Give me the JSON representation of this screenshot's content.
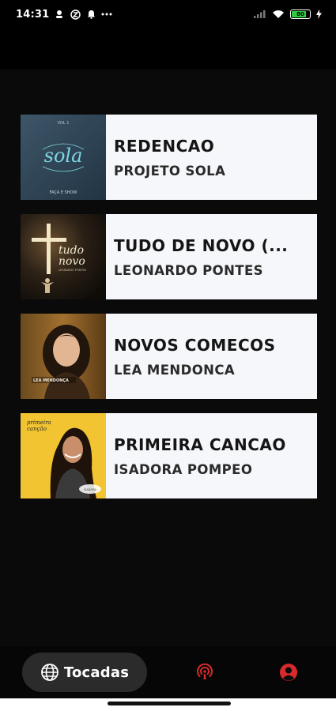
{
  "status_bar": {
    "time": "14:31",
    "icons_left": [
      "person-notification-icon",
      "app-notification-icon",
      "bell-icon",
      "more-dots-icon"
    ],
    "icons_right": [
      "signal-off-icon",
      "wifi-icon",
      "battery-icon",
      "charging-icon"
    ],
    "battery_level": "80",
    "battery_color": "#2ecc40"
  },
  "songs": [
    {
      "title": "REDENCAO",
      "artist": "PROJETO SOLA",
      "cover": "sola-cover"
    },
    {
      "title": "TUDO DE NOVO (...",
      "artist": "LEONARDO PONTES",
      "cover": "tudo-de-novo-cover"
    },
    {
      "title": "NOVOS COMECOS",
      "artist": "LEA MENDONCA",
      "cover": "lea-mendonca-cover"
    },
    {
      "title": "PRIMEIRA CANCAO",
      "artist": "ISADORA POMPEO",
      "cover": "primeira-cancao-cover"
    }
  ],
  "bottom_nav": {
    "active_label": "Tocadas",
    "active_icon": "globe-icon",
    "items": [
      "podcast-icon",
      "profile-icon"
    ],
    "accent_color": "#d72a2a"
  }
}
